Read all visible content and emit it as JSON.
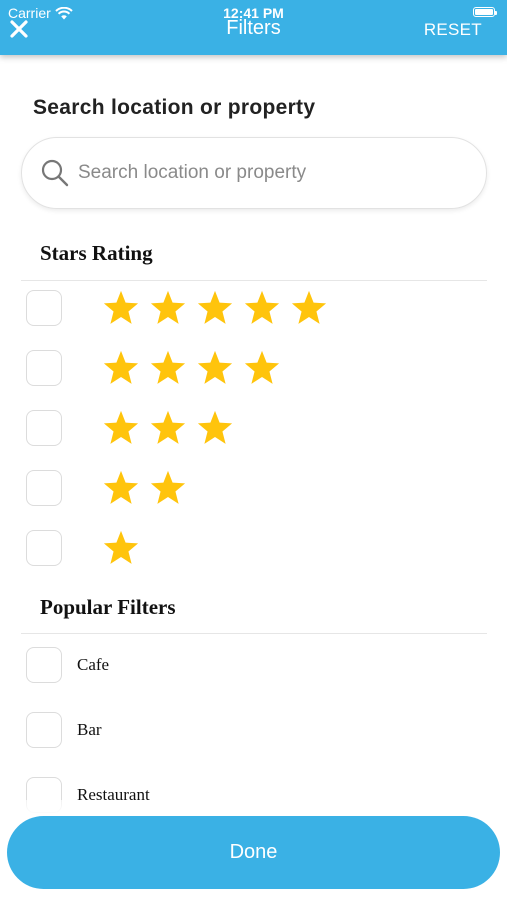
{
  "status_bar": {
    "carrier": "Carrier",
    "time": "12:41 PM"
  },
  "nav": {
    "title": "Filters",
    "reset_label": "RESET",
    "close_icon": "close-icon"
  },
  "search": {
    "title": "Search location or property",
    "placeholder": "Search location or property",
    "value": ""
  },
  "stars_rating": {
    "heading": "Stars Rating",
    "star_color": "#ffc40c",
    "options": [
      {
        "stars": 5,
        "checked": false
      },
      {
        "stars": 4,
        "checked": false
      },
      {
        "stars": 3,
        "checked": false
      },
      {
        "stars": 2,
        "checked": false
      },
      {
        "stars": 1,
        "checked": false
      }
    ]
  },
  "popular_filters": {
    "heading": "Popular Filters",
    "items": [
      {
        "label": "Cafe",
        "checked": false
      },
      {
        "label": "Bar",
        "checked": false
      },
      {
        "label": "Restaurant",
        "checked": false
      }
    ]
  },
  "done_label": "Done",
  "colors": {
    "accent": "#3ab1e5",
    "star": "#ffc40c"
  }
}
